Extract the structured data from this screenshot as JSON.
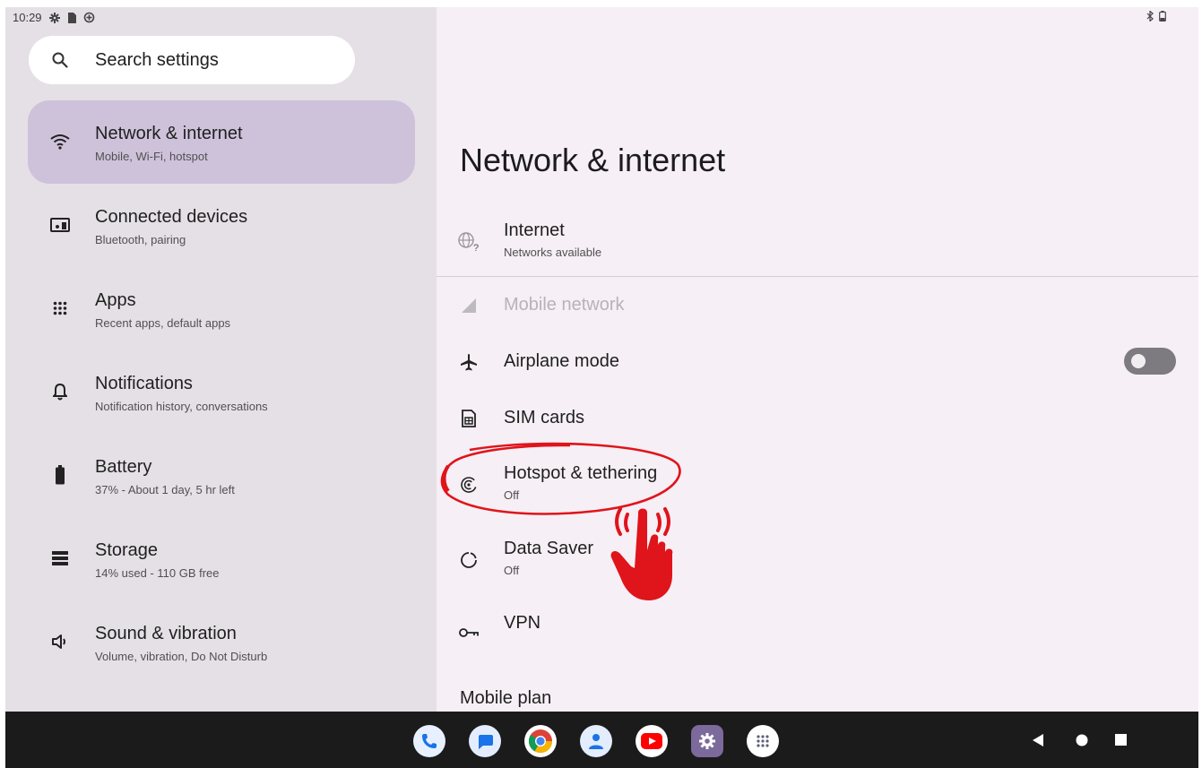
{
  "status_bar": {
    "time": "10:29"
  },
  "search": {
    "placeholder": "Search settings"
  },
  "sidebar": {
    "items": [
      {
        "title": "Network & internet",
        "subtitle": "Mobile, Wi-Fi, hotspot",
        "icon": "wifi-icon",
        "selected": true
      },
      {
        "title": "Connected devices",
        "subtitle": "Bluetooth, pairing",
        "icon": "connected-devices-icon"
      },
      {
        "title": "Apps",
        "subtitle": "Recent apps, default apps",
        "icon": "apps-grid-icon"
      },
      {
        "title": "Notifications",
        "subtitle": "Notification history, conversations",
        "icon": "bell-icon"
      },
      {
        "title": "Battery",
        "subtitle": "37% - About 1 day, 5 hr left",
        "icon": "battery-icon"
      },
      {
        "title": "Storage",
        "subtitle": "14% used - 110 GB free",
        "icon": "storage-icon"
      },
      {
        "title": "Sound & vibration",
        "subtitle": "Volume, vibration, Do Not Disturb",
        "icon": "volume-icon"
      }
    ]
  },
  "main": {
    "title": "Network & internet",
    "rows": [
      {
        "title": "Internet",
        "subtitle": "Networks available",
        "icon": "globe-question-icon"
      },
      {
        "title": "Mobile network",
        "icon": "signal-icon",
        "disabled": true
      },
      {
        "title": "Airplane mode",
        "icon": "airplane-icon",
        "toggle": false
      },
      {
        "title": "SIM cards",
        "icon": "sim-card-icon"
      },
      {
        "title": "Hotspot & tethering",
        "subtitle": "Off",
        "icon": "hotspot-icon"
      },
      {
        "title": "Data Saver",
        "subtitle": "Off",
        "icon": "data-saver-icon"
      },
      {
        "title": "VPN",
        "icon": "vpn-key-icon"
      }
    ],
    "footer_item": "Mobile plan"
  },
  "taskbar": {
    "apps": [
      "phone-app-icon",
      "messages-app-icon",
      "chrome-app-icon",
      "contacts-app-icon",
      "youtube-app-icon",
      "settings-app-icon",
      "all-apps-icon"
    ],
    "nav": [
      "back-icon",
      "home-icon",
      "recents-icon"
    ]
  },
  "colors": {
    "accent_selected": "#cec2db",
    "annotation": "#e0141b"
  }
}
